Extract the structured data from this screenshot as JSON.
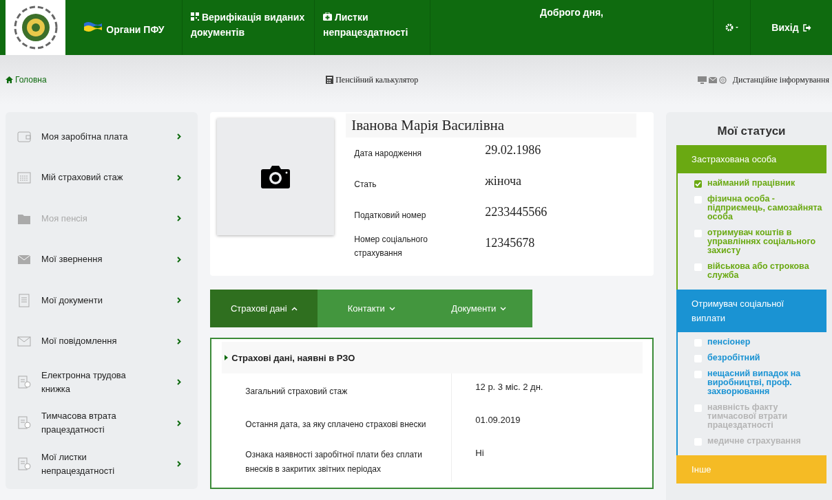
{
  "header": {
    "nav": [
      {
        "label": "Органи ПФУ"
      },
      {
        "label": "Верифікація виданих документів"
      },
      {
        "label": "Листки непрацездатності"
      }
    ],
    "greeting": "Доброго дня,",
    "logout": "Вихід"
  },
  "breadcrumb": {
    "home": "Головна",
    "calculator": "Пенсійний калькулятор",
    "remote": "Дистанційне інформування"
  },
  "sidebar": {
    "items": [
      {
        "label": "Моя заробітна плата",
        "disabled": false
      },
      {
        "label": "Мій страховий стаж",
        "disabled": false
      },
      {
        "label": "Моя пенсія",
        "disabled": true
      },
      {
        "label": "Мої звернення",
        "disabled": false
      },
      {
        "label": "Мої документи",
        "disabled": false
      },
      {
        "label": "Мої повідомлення",
        "disabled": false
      },
      {
        "label": "Електронна трудова книжка",
        "disabled": false
      },
      {
        "label": "Тимчасова втрата працездатності",
        "disabled": false
      },
      {
        "label": "Мої листки непрацездатності",
        "disabled": false
      }
    ]
  },
  "profile": {
    "name": "Іванова Марія Василівна",
    "fields": [
      {
        "label": "Дата народження",
        "value": "29.02.1986"
      },
      {
        "label": "Стать",
        "value": "жіноча"
      },
      {
        "label": "Податковий номер",
        "value": "2233445566"
      },
      {
        "label": "Номер соціального страхування",
        "value": "12345678"
      }
    ]
  },
  "tabs": [
    {
      "label": "Страхові дані",
      "selected": true
    },
    {
      "label": "Контакти",
      "selected": false
    },
    {
      "label": "Документи",
      "selected": false
    }
  ],
  "insurance": {
    "title": "Страхові дані, наявні в РЗО",
    "rows": [
      {
        "label": "Загальний страховий стаж",
        "value": "12 р. 3 міс. 2 дн."
      },
      {
        "label": "Остання дата, за яку сплачено страхові внески",
        "value": "01.09.2019"
      },
      {
        "label": "Ознака наявності заробітної плати без сплати внесків в закритих звітних періодах",
        "value": "Ні"
      }
    ]
  },
  "statuses": {
    "title": "Мої статуси",
    "groups": [
      {
        "title": "Застрахована особа",
        "color": "#6aa912",
        "items": [
          {
            "label": "найманий працівник",
            "checked": true,
            "disabled": false
          },
          {
            "label": "фізична особа - підприємець, самозайнята особа",
            "checked": false,
            "disabled": false
          },
          {
            "label": "отримувач коштів в управліннях соціального захисту",
            "checked": false,
            "disabled": false
          },
          {
            "label": "військова або строкова служба",
            "checked": false,
            "disabled": false
          }
        ]
      },
      {
        "title": "Отримувач соціальної виплати",
        "color": "#1a93d3",
        "items": [
          {
            "label": "пенсіонер",
            "checked": false,
            "disabled": false
          },
          {
            "label": "безробітний",
            "checked": false,
            "disabled": false
          },
          {
            "label": "нещасний випадок на виробництві, проф. захворювання",
            "checked": false,
            "disabled": false
          },
          {
            "label": "наявність факту тимчасової втрати працездатності",
            "checked": false,
            "disabled": true
          },
          {
            "label": "медичне страхування",
            "checked": false,
            "disabled": true
          }
        ]
      },
      {
        "title": "Інше",
        "color": "#f5bb25"
      }
    ]
  }
}
